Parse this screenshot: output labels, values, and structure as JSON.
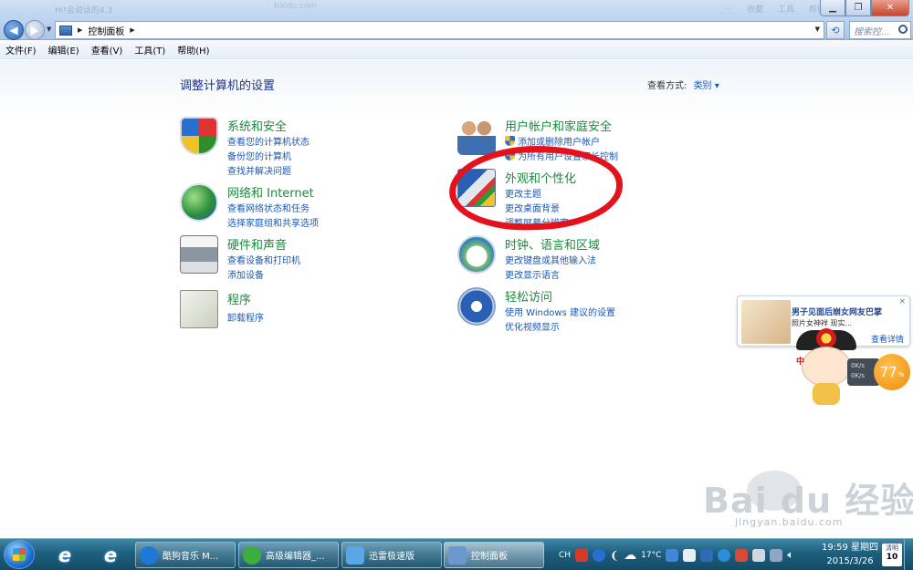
{
  "window": {
    "ghost_title": "Hi!会说话的4.3",
    "ghost_tab": "baidu.com",
    "ghost_buttons": [
      "…",
      "收藏",
      "工具",
      "帮助"
    ]
  },
  "address": {
    "crumb": "控制面板",
    "search_placeholder": "搜索控..."
  },
  "menu": [
    "文件(F)",
    "编辑(E)",
    "查看(V)",
    "工具(T)",
    "帮助(H)"
  ],
  "main": {
    "heading": "调整计算机的设置",
    "view_by_label": "查看方式:",
    "view_by_value": "类别 ▾"
  },
  "categories": [
    {
      "title": "系统和安全",
      "icon": "shield-icon",
      "links": [
        "查看您的计算机状态",
        "备份您的计算机",
        "查找并解决问题"
      ]
    },
    {
      "title": "网络和 Internet",
      "icon": "globe-network-icon",
      "links": [
        "查看网络状态和任务",
        "选择家庭组和共享选项"
      ]
    },
    {
      "title": "硬件和声音",
      "icon": "printer-icon",
      "links": [
        "查看设备和打印机",
        "添加设备"
      ]
    },
    {
      "title": "程序",
      "icon": "program-icon",
      "links": [
        "卸载程序"
      ]
    },
    {
      "title": "用户帐户和家庭安全",
      "icon": "users-icon",
      "links": [
        "添加或删除用户帐户",
        "为所有用户设置家长控制"
      ]
    },
    {
      "title": "外观和个性化",
      "icon": "appearance-icon",
      "links": [
        "更改主题",
        "更改桌面背景",
        "调整屏幕分辨率"
      ]
    },
    {
      "title": "时钟、语言和区域",
      "icon": "clock-globe-icon",
      "links": [
        "更改键盘或其他输入法",
        "更改显示语言"
      ]
    },
    {
      "title": "轻松访问",
      "icon": "ease-of-access-icon",
      "links": [
        "使用 Windows 建议的设置",
        "优化视频显示"
      ]
    }
  ],
  "popup": {
    "title": "男子见面后崩女网友巴掌",
    "subtitle": "照片女神祥 现实...",
    "more": "查看详情",
    "close": "×"
  },
  "speed": {
    "value": "77",
    "unit": "%",
    "up": "0K/s",
    "down": "0K/s",
    "badge": "中"
  },
  "watermark": {
    "brand": "Bai du 经验",
    "url": "jingyan.baidu.com"
  },
  "taskbar": {
    "items": [
      {
        "label": "酷狗音乐 M...",
        "icon": "kugou-icon"
      },
      {
        "label": "高级编辑器_...",
        "icon": "editor-icon"
      },
      {
        "label": "迅雷极速版",
        "icon": "xunlei-icon"
      },
      {
        "label": "控制面板",
        "icon": "control-panel-icon"
      }
    ],
    "tray_lang": "CH",
    "weather": "17°C",
    "time": "19:59 星期四",
    "date": "2015/3/26",
    "calendar_label": "清明",
    "calendar_day": "10"
  },
  "colors": {
    "link": "#1a58b6",
    "category": "#1d8a3e",
    "annotation": "#e3121d"
  }
}
